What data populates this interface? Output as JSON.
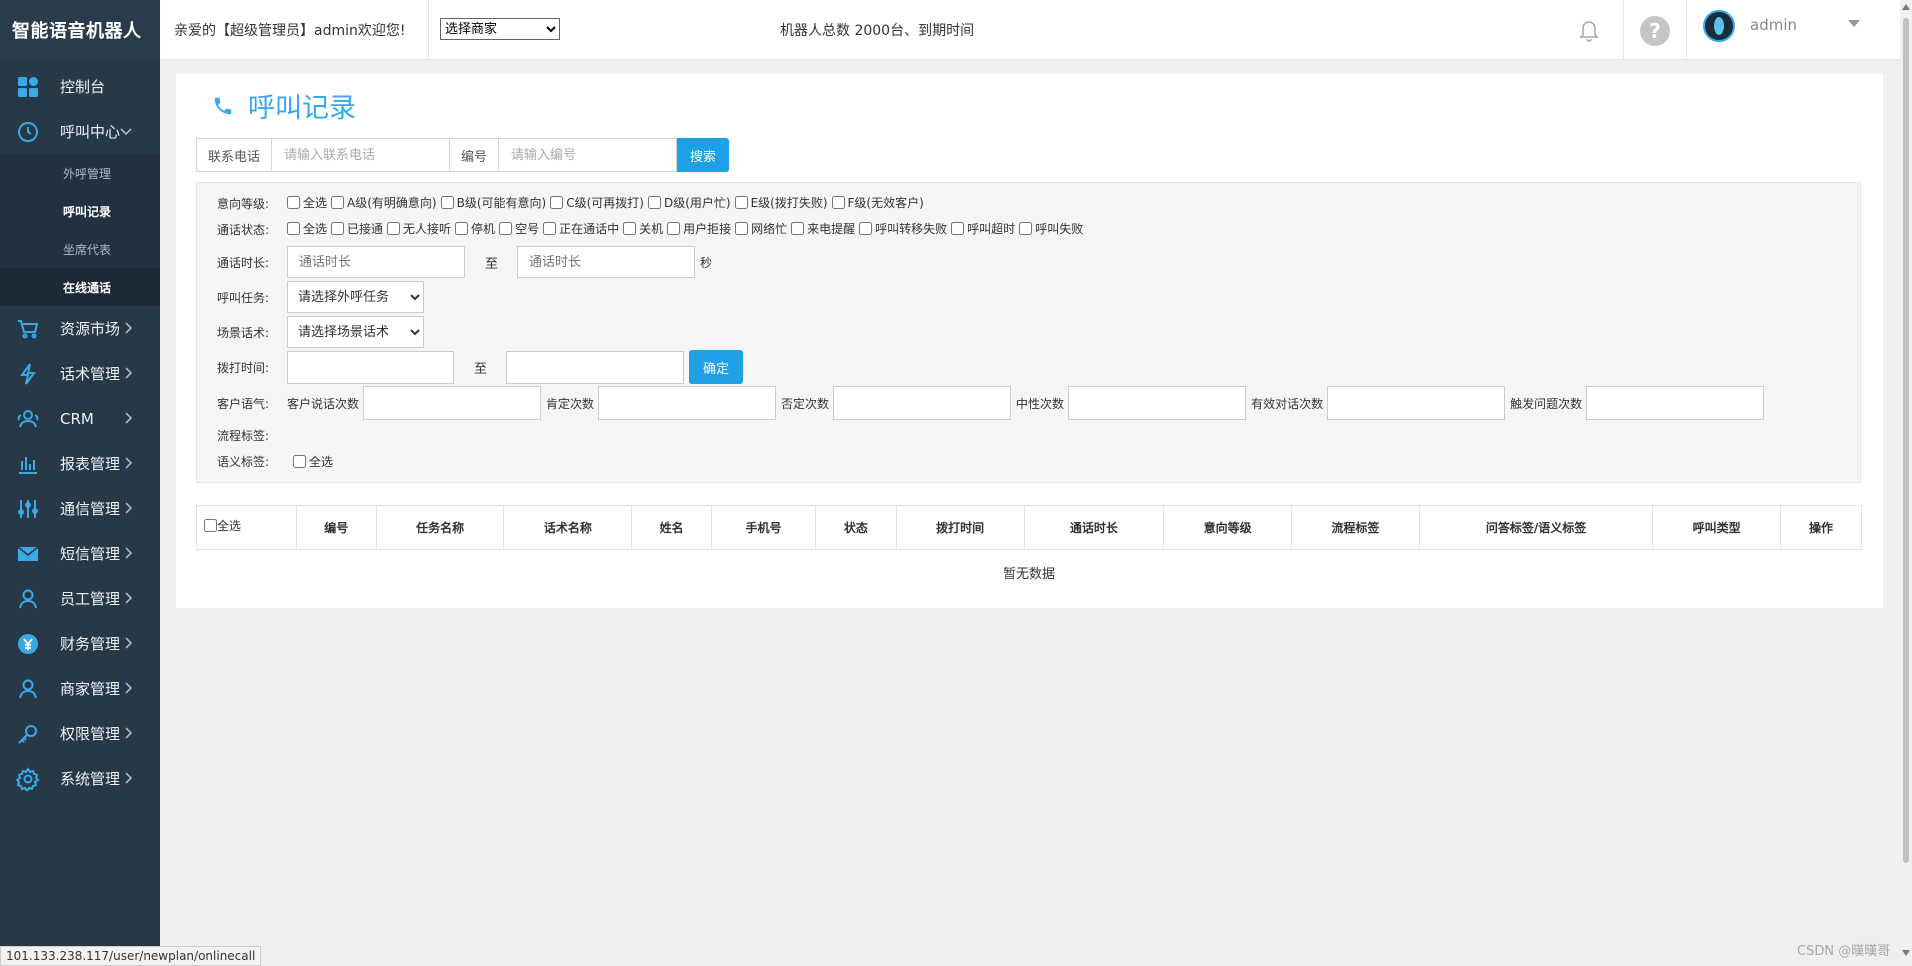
{
  "app": {
    "title": "智能语音机器人"
  },
  "sidebar": {
    "items": [
      {
        "label": "控制台",
        "icon": "dashboard-icon"
      },
      {
        "label": "呼叫中心",
        "icon": "clock-icon",
        "expanded": true,
        "children": [
          "外呼管理",
          "呼叫记录",
          "坐席代表",
          "在线通话"
        ]
      },
      {
        "label": "资源市场",
        "icon": "cart-icon"
      },
      {
        "label": "话术管理",
        "icon": "lightning-icon"
      },
      {
        "label": "CRM",
        "icon": "users-icon"
      },
      {
        "label": "报表管理",
        "icon": "bar-chart-icon"
      },
      {
        "label": "通信管理",
        "icon": "sliders-icon"
      },
      {
        "label": "短信管理",
        "icon": "mail-icon"
      },
      {
        "label": "员工管理",
        "icon": "person-icon"
      },
      {
        "label": "财务管理",
        "icon": "yen-icon"
      },
      {
        "label": "商家管理",
        "icon": "merchant-icon"
      },
      {
        "label": "权限管理",
        "icon": "key-icon"
      },
      {
        "label": "系统管理",
        "icon": "settings-icon"
      }
    ]
  },
  "topbar": {
    "welcome": "亲爱的【超级管理员】admin欢迎您!",
    "merchant_select": "选择商家",
    "robot_info": "机器人总数 2000台、到期时间",
    "username": "admin",
    "help_glyph": "?"
  },
  "page": {
    "title": "呼叫记录"
  },
  "search": {
    "phone_label": "联系电话",
    "phone_placeholder": "请输入联系电话",
    "id_label": "编号",
    "id_placeholder": "请输入编号",
    "button": "搜索"
  },
  "filters": {
    "intent": {
      "label": "意向等级:",
      "options": [
        "全选",
        "A级(有明确意向)",
        "B级(可能有意向)",
        "C级(可再拨打)",
        "D级(用户忙)",
        "E级(拨打失败)",
        "F级(无效客户)"
      ]
    },
    "call_status": {
      "label": "通话状态:",
      "options": [
        "全选",
        "已接通",
        "无人接听",
        "停机",
        "空号",
        "正在通话中",
        "关机",
        "用户拒接",
        "网络忙",
        "来电提醒",
        "呼叫转移失败",
        "呼叫超时",
        "呼叫失败"
      ]
    },
    "duration": {
      "label": "通话时长:",
      "placeholder": "通话时长",
      "to": "至",
      "unit": "秒"
    },
    "task": {
      "label": "呼叫任务:",
      "selected": "请选择外呼任务"
    },
    "script": {
      "label": "场景话术:",
      "selected": "请选择场景话术"
    },
    "dial_time": {
      "label": "拨打时间:",
      "to": "至",
      "confirm": "确定"
    },
    "customer_tone": {
      "label": "客户语气:",
      "fields": [
        "客户说话次数",
        "肯定次数",
        "否定次数",
        "中性次数",
        "有效对话次数",
        "触发问题次数"
      ]
    },
    "flow_tag": {
      "label": "流程标签:"
    },
    "semantic_tag": {
      "label": "语义标签:",
      "option": "全选"
    }
  },
  "table": {
    "select_all": "全选",
    "columns": [
      "编号",
      "任务名称",
      "话术名称",
      "姓名",
      "手机号",
      "状态",
      "拨打时间",
      "通话时长",
      "意向等级",
      "流程标签",
      "问答标签/语义标签",
      "呼叫类型",
      "操作"
    ],
    "empty": "暂无数据"
  },
  "statusbar": {
    "url": "101.133.238.117/user/newplan/onlinecall"
  },
  "watermark": "CSDN @暵暵哥",
  "colors": {
    "accent": "#39a8e6",
    "sidebar": "#273847",
    "button": "#1ea0e6"
  }
}
